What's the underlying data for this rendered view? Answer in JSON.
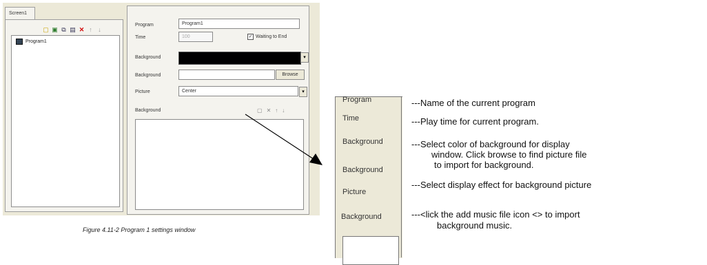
{
  "window": {
    "tab_label": "Screen1",
    "tree_item": "Program1",
    "toolbar_icons": [
      "add-icon",
      "copy-icon",
      "duplicate-icon",
      "paste-icon",
      "delete-icon",
      "up-icon",
      "down-icon"
    ],
    "settings": {
      "program_label": "Program",
      "program_value": "Program1",
      "time_label": "Time",
      "time_value": "100",
      "waiting_label": "Waiting to End",
      "background_color_label": "Background",
      "background_color": "#000000",
      "background_file_label": "Background",
      "browse_label": "Browse",
      "picture_label": "Picture",
      "picture_value": "Center",
      "music_label": "Background"
    }
  },
  "caption": "Figure 4.11-2 Program 1 settings window",
  "zoom_labels": [
    "Program",
    "Time",
    "Background",
    "Background",
    "Picture",
    "Background"
  ],
  "descriptions": {
    "d1": "---Name of the current program",
    "d2": "---Play time for current program.",
    "d3a": "---Select color of background for display",
    "d3b": "window.  Click browse to find picture file",
    "d3c": "to import for background.",
    "d4": "---Select display effect for background picture",
    "d5a": "---<lick the add music file icon <> to import",
    "d5b": "background music."
  }
}
